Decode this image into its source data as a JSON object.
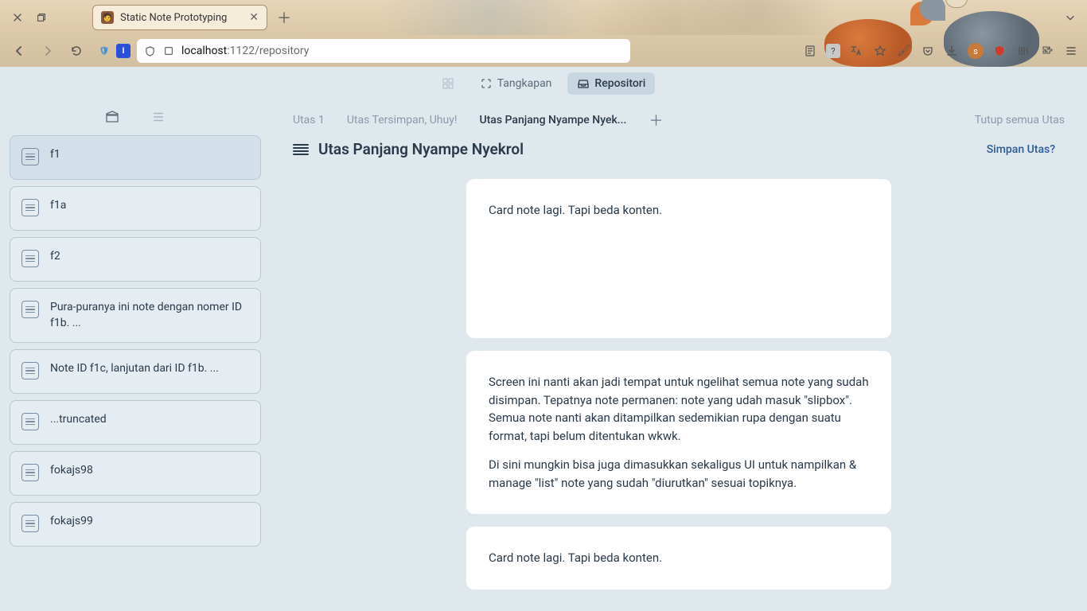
{
  "browser": {
    "tab_title": "Static Note Prototyping",
    "url_host": "localhost",
    "url_port": ":1122",
    "url_path": "/repository"
  },
  "top_nav": {
    "items": [
      {
        "label": "",
        "icon": "grid"
      },
      {
        "label": "Tangkapan",
        "icon": "capture"
      },
      {
        "label": "Repositori",
        "icon": "tray"
      }
    ]
  },
  "sidebar": {
    "cards": [
      {
        "text": "f1"
      },
      {
        "text": "f1a"
      },
      {
        "text": "f2"
      },
      {
        "text": "Pura-puranya ini note dengan nomer ID f1b. ..."
      },
      {
        "text": "Note ID f1c, lanjutan dari ID f1b. ..."
      },
      {
        "text": "...truncated"
      },
      {
        "text": "fokajs98"
      },
      {
        "text": "fokajs99"
      }
    ]
  },
  "threads": {
    "tabs": [
      {
        "label": "Utas 1"
      },
      {
        "label": "Utas Tersimpan, Uhuy!"
      },
      {
        "label": "Utas Panjang Nyampe Nyek..."
      }
    ],
    "close_all_label": "Tutup semua Utas",
    "title": "Utas Panjang Nyampe Nyekrol",
    "save_label": "Simpan Utas?"
  },
  "notes": [
    {
      "paragraphs": [
        "Card note lagi. Tapi beda konten."
      ],
      "tall": true
    },
    {
      "paragraphs": [
        "Screen ini nanti akan jadi tempat untuk ngelihat semua note yang sudah disimpan. Tepatnya note permanen: note yang udah masuk \"slipbox\". Semua note nanti akan ditampilkan sedemikian rupa dengan suatu format, tapi belum ditentukan wkwk.",
        "Di sini mungkin bisa juga dimasukkan sekaligus UI untuk nampilkan & manage \"list\" note yang sudah \"diurutkan\" sesuai topiknya."
      ],
      "tall": false
    },
    {
      "paragraphs": [
        "Card note lagi. Tapi beda konten."
      ],
      "tall": false
    }
  ]
}
